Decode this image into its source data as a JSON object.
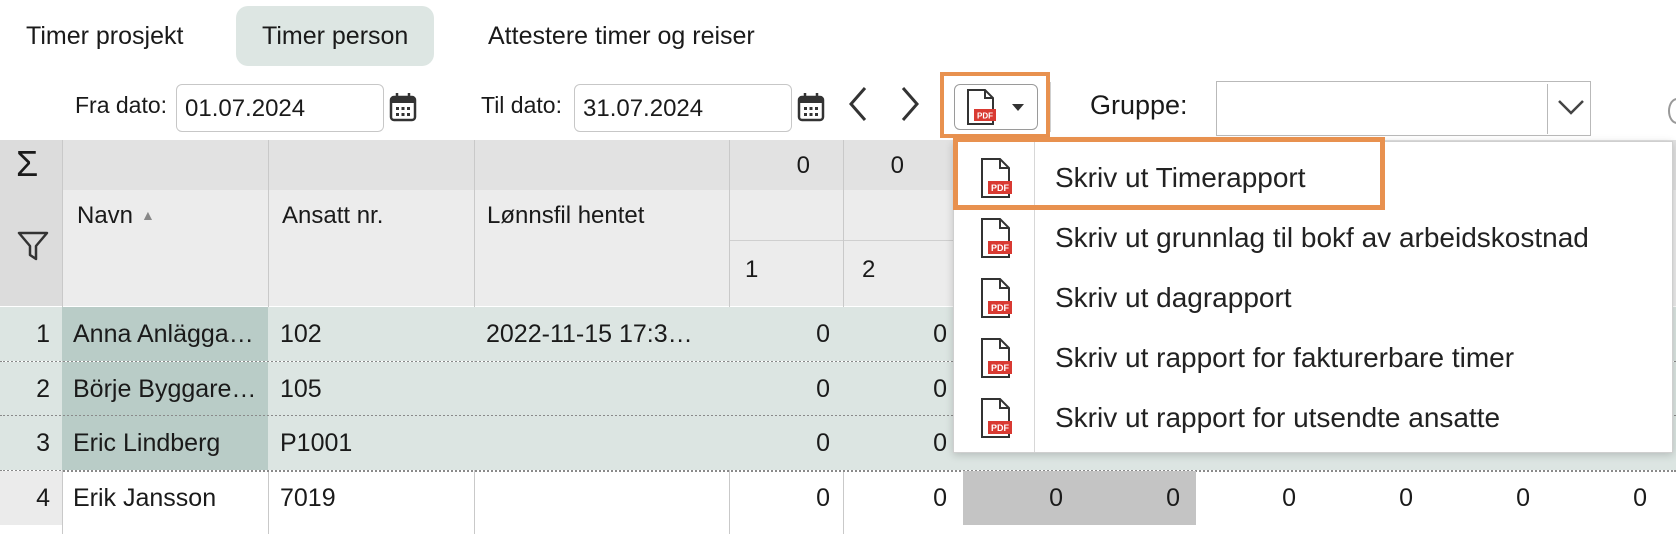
{
  "tabs": [
    {
      "label": "Timer prosjekt",
      "active": false
    },
    {
      "label": "Timer person",
      "active": true
    },
    {
      "label": "Attestere timer og reiser",
      "active": false
    }
  ],
  "filters": {
    "fra_label": "Fra dato:",
    "fra_value": "01.07.2024",
    "til_label": "Til dato:",
    "til_value": "31.07.2024",
    "gruppe_label": "Gruppe:",
    "gruppe_value": ""
  },
  "grid": {
    "sum_symbol": "Σ",
    "sum_values": [
      "0",
      "0"
    ],
    "columns": {
      "navn": "Navn",
      "ansatt": "Ansatt nr.",
      "lonnsfil": "Lønnsfil hentet",
      "day1": "1",
      "day2": "2"
    },
    "rows": [
      {
        "n": "1",
        "name": "Anna Anlägga…",
        "ansatt": "102",
        "lonnsfil": "2022-11-15 17:3…",
        "d1": "0",
        "d2": "0",
        "selected": true
      },
      {
        "n": "2",
        "name": "Börje Byggare…",
        "ansatt": "105",
        "lonnsfil": "",
        "d1": "0",
        "d2": "0",
        "selected": true
      },
      {
        "n": "3",
        "name": "Eric Lindberg",
        "ansatt": "P1001",
        "lonnsfil": "",
        "d1": "0",
        "d2": "0",
        "selected": true
      },
      {
        "n": "4",
        "name": "Erik Jansson",
        "ansatt": "7019",
        "lonnsfil": "",
        "d1": "0",
        "d2": "0",
        "selected": false,
        "extra": [
          "0",
          "0",
          "0",
          "0",
          "0",
          "0"
        ]
      }
    ]
  },
  "print_menu": {
    "items": [
      {
        "label": "Skriv ut Timerapport",
        "icon": "pdf-icon"
      },
      {
        "label": "Skriv ut grunnlag til bokf av arbeidskostnad",
        "icon": "pdf-icon"
      },
      {
        "label": "Skriv ut dagrapport",
        "icon": "pdf-icon"
      },
      {
        "label": "Skriv ut rapport for fakturerbare timer",
        "icon": "pdf-icon"
      },
      {
        "label": "Skriv ut rapport for utsendte ansatte",
        "icon": "pdf-icon"
      }
    ],
    "pdf_badge": "PDF"
  },
  "colors": {
    "highlight": "#e8914f",
    "selected_row": "#dce5e2",
    "selected_name": "#b9ccc7",
    "active_tab": "#dde6e3",
    "pdf_red": "#d93a32"
  }
}
